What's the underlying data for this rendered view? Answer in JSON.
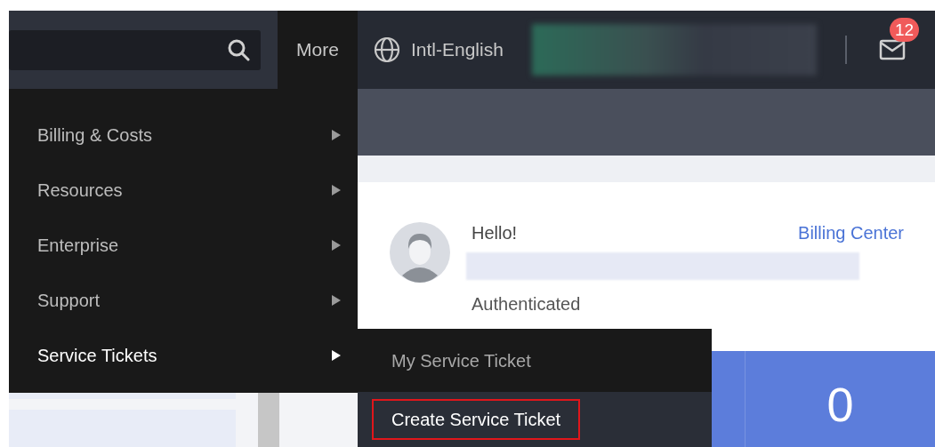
{
  "top_bar": {
    "more": "More",
    "language": "Intl-English",
    "notifications_badge": "12"
  },
  "menu": [
    {
      "label": "Billing & Costs",
      "selected": false
    },
    {
      "label": "Resources",
      "selected": false
    },
    {
      "label": "Enterprise",
      "selected": false
    },
    {
      "label": "Support",
      "selected": false
    },
    {
      "label": "Service Tickets",
      "selected": true
    }
  ],
  "submenu": [
    {
      "label": "My Service Ticket",
      "selected": false,
      "highlighted": false
    },
    {
      "label": "Create Service Ticket",
      "selected": true,
      "highlighted": true
    }
  ],
  "account": {
    "greeting": "Hello!",
    "link": "Billing Center",
    "status": "Authenticated"
  },
  "stats": [
    {
      "value": "0"
    }
  ]
}
